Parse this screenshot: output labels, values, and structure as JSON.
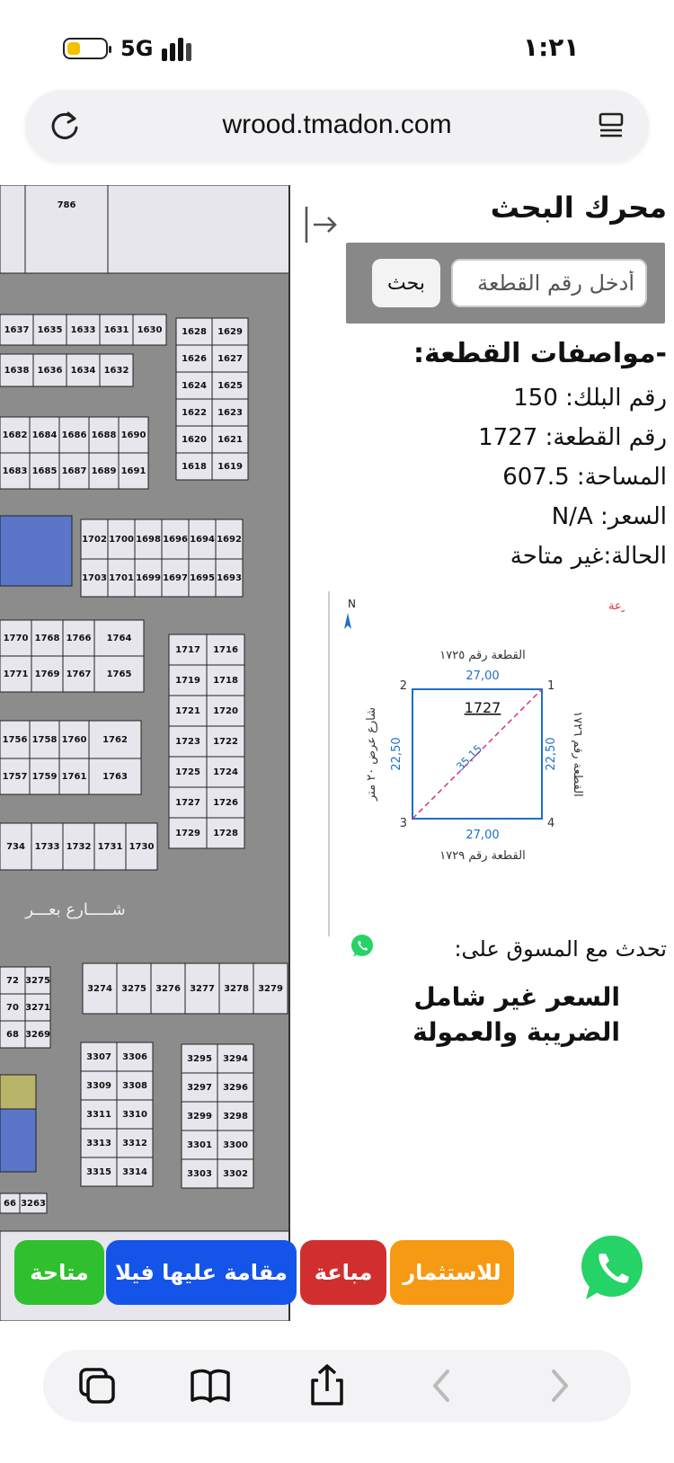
{
  "status": {
    "network": "5G",
    "time": "١:٢١",
    "colors": {
      "battery": "#f2c200"
    }
  },
  "browser": {
    "url": "wrood.tmadon.com",
    "icons": [
      "reload-icon",
      "reader-menu-icon",
      "tabs-icon",
      "bookmarks-icon",
      "share-icon",
      "back-icon",
      "forward-icon"
    ]
  },
  "panel": {
    "title": "محرك البحث",
    "search_placeholder": "أدخل رقم القطعة",
    "search_button": "بحث",
    "specs_heading": "-مواصفات القطعة:",
    "block_label": "رقم البلك:",
    "block_value": "150",
    "plot_label": "رقم القطعة:",
    "plot_value": "1727",
    "area_label": "المساحة:",
    "area_value": "607.5",
    "price_label": "السعر:",
    "price_value": "N/A",
    "status_label": "الحالة:",
    "status_value": "غير متاحة",
    "chat_text": "تحدث مع المسوق على:",
    "price_note": "السعر غير شامل الضريبة والعمولة"
  },
  "sketch": {
    "north": "N",
    "title": "أ- كروكي وقرار ذرعة",
    "plot_number": "1727",
    "top_neighbor": "القطعة رقم ١٧٢٥",
    "bottom_neighbor": "القطعة رقم ١٧٢٩",
    "right_neighbor": "القطعة رقم ١٧٢٦",
    "left_street": "شارع عرض ٢٠ متر",
    "dim_top": "27,00",
    "dim_bottom": "27,00",
    "dim_left": "22,50",
    "dim_right": "22,50",
    "dim_diagonal": "35,15",
    "corner_1": "1",
    "corner_2": "2",
    "corner_3": "3",
    "corner_4": "4",
    "colors": {
      "outline": "#1e6fc8",
      "diagonal": "#e0307a",
      "title": "#d33"
    }
  },
  "map": {
    "street_label": "شـــــارع بعـــر",
    "lots": {
      "top": "786",
      "a": [
        "1637",
        "1635",
        "1633",
        "1631",
        "1630",
        "1638",
        "1636",
        "1634",
        "1632"
      ],
      "b": [
        "1628",
        "1629",
        "1626",
        "1627",
        "1624",
        "1625",
        "1622",
        "1623",
        "1620",
        "1621",
        "1618",
        "1619"
      ],
      "c": [
        "1682",
        "1684",
        "1686",
        "1688",
        "1690",
        "1683",
        "1685",
        "1687",
        "1689",
        "1691"
      ],
      "d": [
        "1702",
        "1700",
        "1698",
        "1696",
        "1694",
        "1692",
        "1703",
        "1701",
        "1699",
        "1697",
        "1695",
        "1693"
      ],
      "e": [
        "1770",
        "1768",
        "1766",
        "1764",
        "1771",
        "1769",
        "1767",
        "1765"
      ],
      "f": [
        "1717",
        "1716",
        "1719",
        "1718",
        "1721",
        "1720",
        "1723",
        "1722",
        "1725",
        "1724",
        "1727",
        "1726",
        "1729",
        "1728"
      ],
      "g": [
        "1756",
        "1758",
        "1760",
        "1762",
        "1757",
        "1759",
        "1761",
        "1763"
      ],
      "h": [
        "734",
        "1733",
        "1732",
        "1731",
        "1730"
      ],
      "i": [
        "72",
        "3275",
        "70",
        "3271",
        "68",
        "3269"
      ],
      "j": [
        "3274",
        "3275",
        "3276",
        "3277",
        "3278",
        "3279"
      ],
      "k": [
        "3307",
        "3306",
        "3309",
        "3308",
        "3311",
        "3310",
        "3313",
        "3312",
        "3315",
        "3314"
      ],
      "l": [
        "3295",
        "3294",
        "3297",
        "3296",
        "3299",
        "3298",
        "3301",
        "3300",
        "3303",
        "3302"
      ],
      "m": [
        "66",
        "3263"
      ]
    },
    "colors": {
      "road": "#8c8c8c",
      "lot": "#e6e6ec",
      "blue": "#5b76c9",
      "olive": "#b8b46a"
    }
  },
  "legend": {
    "investment": "للاستثمار",
    "sold": "مباعة",
    "built": "مقامة عليها فيلا",
    "available": "متاحة",
    "colors": {
      "investment": "#f59a12",
      "sold": "#d12f2f",
      "built": "#1554e8",
      "available": "#2fbf2f",
      "whatsapp": "#25d366"
    }
  }
}
